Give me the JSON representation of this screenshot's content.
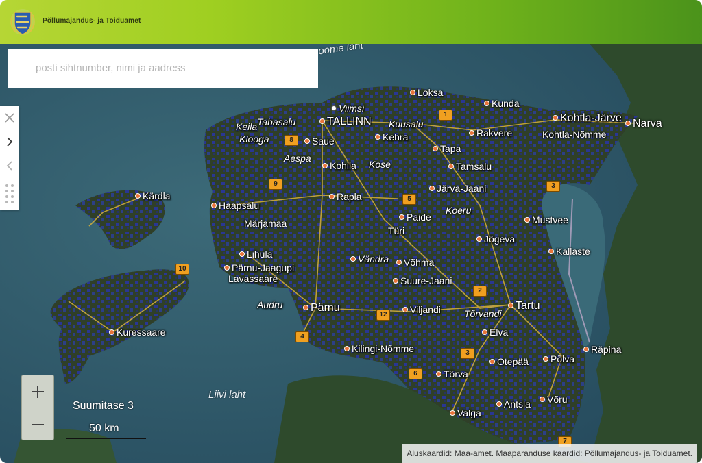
{
  "header": {
    "brand": "Põllumajandus- ja Toiduamet",
    "logo_icon": "estonia-coat-of-arms-icon"
  },
  "search": {
    "placeholder": "posti sihtnumber, nimi ja aadress",
    "value": ""
  },
  "side_tools": [
    {
      "name": "close-icon",
      "glyph": "✕"
    },
    {
      "name": "chevron-right-icon",
      "glyph": "›"
    },
    {
      "name": "chevron-left-icon",
      "glyph": "‹"
    },
    {
      "name": "drag-handle-icon",
      "glyph": "⠿"
    }
  ],
  "map": {
    "zoom_in_label": "+",
    "zoom_out_label": "−",
    "zoom_level_text": "Suumitase 3",
    "scale_text": "50 km",
    "attribution": "Aluskaardid: Maa-amet. Maaparanduse kaardid: Põllumajandus- ja Toiduamet.",
    "water_labels": [
      "oome laht",
      "Liivi laht"
    ],
    "places": [
      "Loksa",
      "Kunda",
      "Viimsi",
      "Kohtla-Järve",
      "Narva",
      "Tabasalu",
      "TALLINN",
      "Kuusalu",
      "Rakvere",
      "Kohtla-Nõmme",
      "Keila",
      "Saue",
      "Kehra",
      "Klooga",
      "Tapa",
      "Aespa",
      "Kohila",
      "Kose",
      "Tamsalu",
      "Järva-Jaani",
      "Kärdla",
      "Haapsalu",
      "Rapla",
      "Koeru",
      "Mustvee",
      "Märjamaa",
      "Paide",
      "Türi",
      "Jõgeva",
      "Lihula",
      "Kallaste",
      "Vändra",
      "Võhma",
      "Pärnu-Jaagupi",
      "Lavassaare",
      "Suure-Jaani",
      "Audru",
      "Pärnu",
      "Viljandi",
      "Tartu",
      "Tõrvandi",
      "Kuressaare",
      "Elva",
      "Kilingi-Nõmme",
      "Räpina",
      "Otepää",
      "Põlva",
      "Tõrva",
      "Võru",
      "Antsla",
      "Valga"
    ],
    "road_shields": [
      "8",
      "9",
      "10",
      "4",
      "5",
      "1",
      "3",
      "2",
      "12",
      "6",
      "3",
      "7"
    ]
  },
  "colors": {
    "header_start": "#b6d635",
    "header_end": "#4b931b",
    "sea": "#2d5566",
    "land": "#2f3d2a",
    "drainage_overlay": "#2a3aa8",
    "town_dot": "#e8743a",
    "road_shield": "#f0a020"
  }
}
